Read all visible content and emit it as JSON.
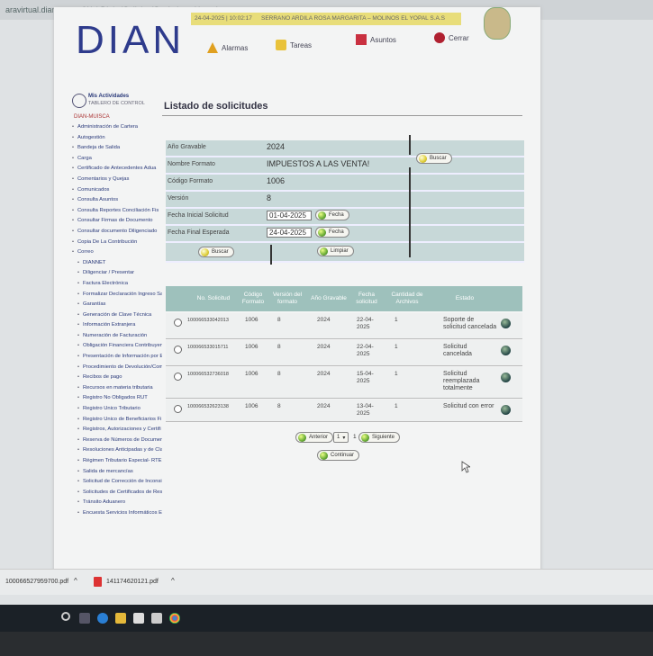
{
  "browser": {
    "url": "aravirtual.dian.gov.co/WebDigitalSolicitudSegimientoUsuario"
  },
  "header": {
    "logo": "DIAN",
    "datetime": "24-04-2025 | 10:02:17",
    "user_bar": "SERRANO ARDILA ROSA MARGARITA – MOLINOS EL YOPAL S.A.S",
    "buttons": {
      "alarmas": "Alarmas",
      "tareas": "Tareas",
      "asuntos": "Asuntos",
      "cerrar": "Cerrar"
    }
  },
  "sidebar": {
    "title": "Mis Actividades",
    "subtitle": "TABLERO DE CONTROL",
    "user": "DIAN-MUISCA",
    "items": [
      "Administración de Cartera",
      "Autogestión",
      "Bandeja de Salida",
      "Carga",
      "Certificado de Antecedentes Adua",
      "Comentarios y Quejas",
      "Comunicados",
      "Consulta Asuntos",
      "Consulta Reportes Conciliación Fis",
      "Consultar Firmas de Documento",
      "Consultar documento Diligenciado",
      "Copia De La Contribución",
      "Correo",
      "DIANNET",
      "Diligenciar / Presentar",
      "Factura Electrónica",
      "Formalizar Declaración Ingreso Sa",
      "Garantías",
      "Generación de Clave Técnica",
      "Información Extranjera",
      "Numeración de Facturación",
      "Obligación Financiera Contribuyen",
      "Presentación de Información por E",
      "Procedimiento de Devolución/Com",
      "Recibos de pago",
      "Recursos en materia tributaria",
      "Registro No Obligados RUT",
      "Registro Único Tributario",
      "Registro Único de Beneficiarios Fi",
      "Registros, Autorizaciones y Certifi",
      "Reserva de Números de Documen",
      "Resoluciones Anticipadas y de Cla",
      "Régimen Tributario Especial- RTE",
      "Salida de mercancías",
      "Solicitud de Corrección de Inconsi",
      "Solicitudes de Certificados de Resi",
      "Tránsito Aduanero",
      "Encuesta Servicios Informáticos El"
    ]
  },
  "main": {
    "title": "Listado de solicitudes",
    "form": {
      "ano_label": "Año Gravable",
      "ano_value": "2024",
      "nombre_label": "Nombre Formato",
      "nombre_value": "IMPUESTOS A LAS VENTA!",
      "codigo_label": "Código Formato",
      "codigo_value": "1006",
      "version_label": "Versión",
      "version_value": "8",
      "fecha_ini_label": "Fecha Inicial Solicitud",
      "fecha_ini_value": "01-04-2025",
      "fecha_fin_label": "Fecha Final Esperada",
      "fecha_fin_value": "24-04-2025",
      "fecha_btn": "Fecha",
      "buscar_right": "Buscar",
      "buscar_bottom": "Buscar",
      "limpiar": "Limpiar"
    },
    "table": {
      "headers": [
        "No. Solicitud",
        "Código Formato",
        "Versión del formato",
        "Año Gravable",
        "Fecha solicitud",
        "Cantidad de Archivos",
        "Estado"
      ],
      "rows": [
        {
          "no": "100066533042013",
          "codigo": "1006",
          "version": "8",
          "ano": "2024",
          "fecha": "22-04-2025",
          "cantidad": "1",
          "estado": "Soporte de solicitud cancelada"
        },
        {
          "no": "100066533015711",
          "codigo": "1006",
          "version": "8",
          "ano": "2024",
          "fecha": "22-04-2025",
          "cantidad": "1",
          "estado": "Solicitud cancelada"
        },
        {
          "no": "100066532736018",
          "codigo": "1006",
          "version": "8",
          "ano": "2024",
          "fecha": "15-04-2025",
          "cantidad": "1",
          "estado": "Solicitud reemplazada totalmente"
        },
        {
          "no": "100066532623138",
          "codigo": "1006",
          "version": "8",
          "ano": "2024",
          "fecha": "13-04-2025",
          "cantidad": "1",
          "estado": "Solicitud con error"
        }
      ]
    },
    "pager": {
      "anterior": "Anterior",
      "page": "1",
      "of": "1",
      "siguiente": "Siguiente",
      "continuar": "Continuar"
    }
  },
  "downloads": {
    "file1": "100066527959700.pdf",
    "file2": "141174620121.pdf"
  }
}
